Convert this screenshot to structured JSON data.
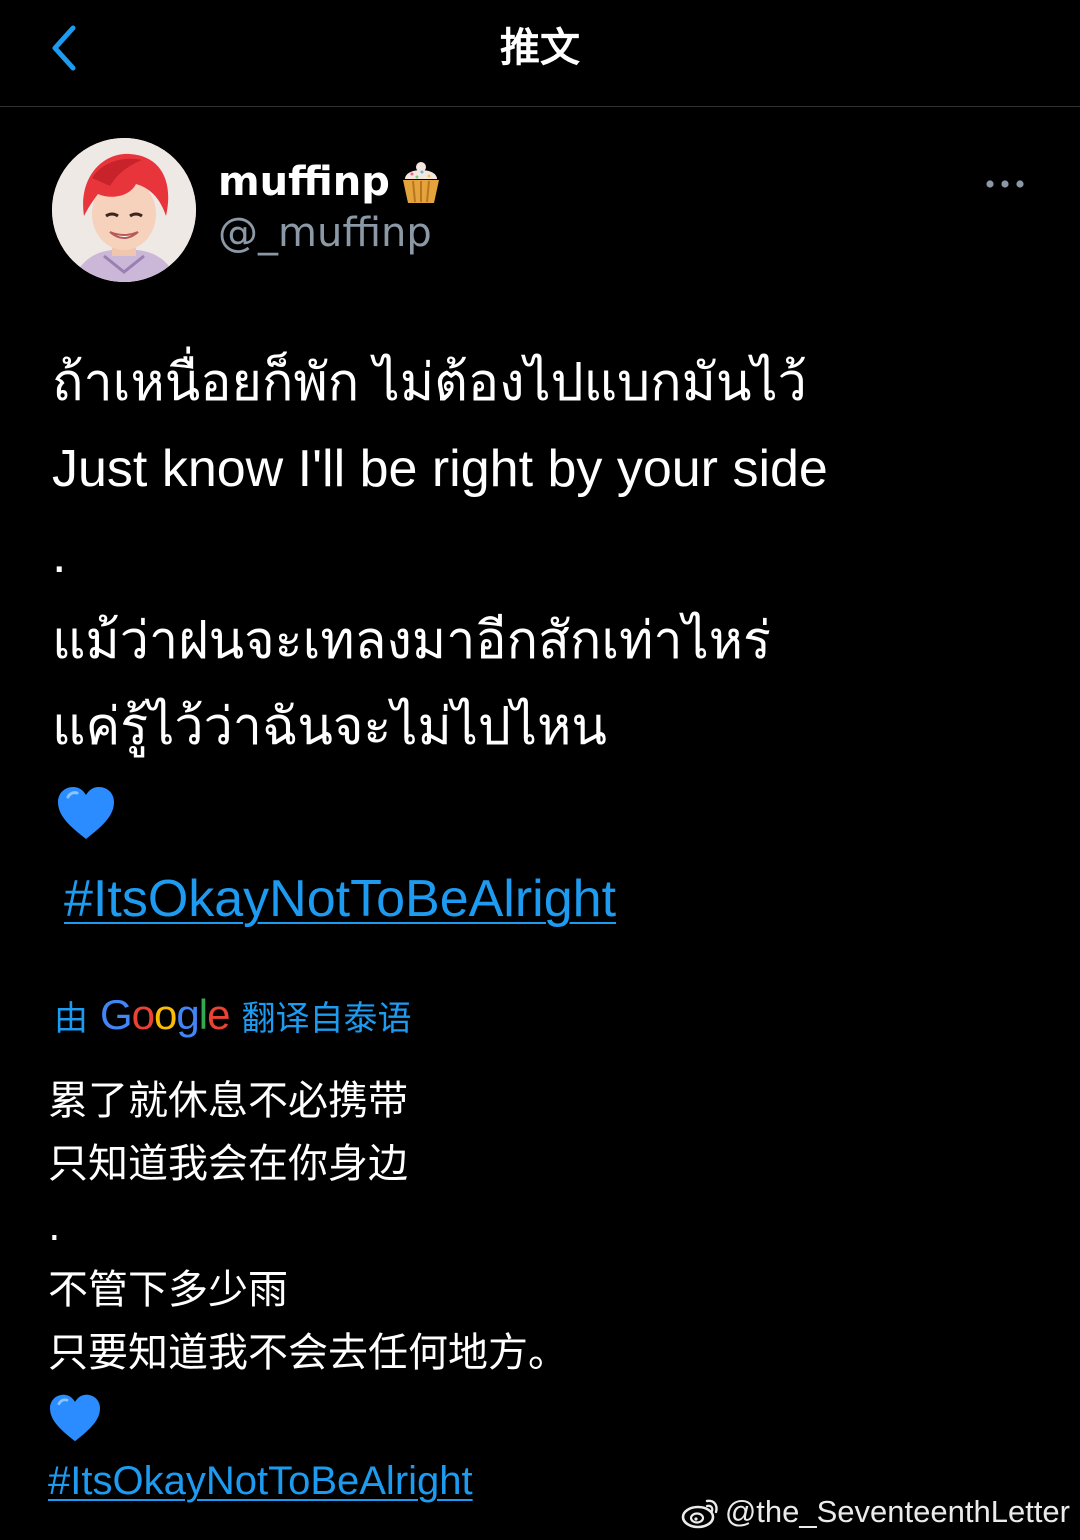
{
  "header": {
    "title": "推文"
  },
  "author": {
    "display_name": "muffinp",
    "handle": "@_muffinp",
    "avatar_hair_color": "#e8353c"
  },
  "tweet": {
    "lines": [
      "ถ้าเหนื่อยก็พัก ไม่ต้องไปแบกมันไว้",
      "Just know I'll be right by your side",
      ".",
      "แม้ว่าฝนจะเทลงมาอีกสักเท่าไหร่",
      "แค่รู้ไว้ว่าฉันจะไม่ไปไหน"
    ],
    "heart": "💙",
    "hashtag": "#ItsOkayNotToBeAlright"
  },
  "translation": {
    "prefix": "由",
    "provider": "Google",
    "suffix": "翻译自泰语",
    "lines": [
      "累了就休息不必携带",
      "只知道我会在你身边",
      ".",
      "不管下多少雨",
      "只要知道我不会去任何地方。"
    ],
    "heart": "💙",
    "hashtag": "#ItsOkayNotToBeAlright"
  },
  "watermark": {
    "text": "@the_SeventeenthLetter"
  },
  "colors": {
    "background": "#000000",
    "link": "#1d9bf0",
    "secondary_text": "#8b98a5",
    "heart": "#2b8cff"
  }
}
